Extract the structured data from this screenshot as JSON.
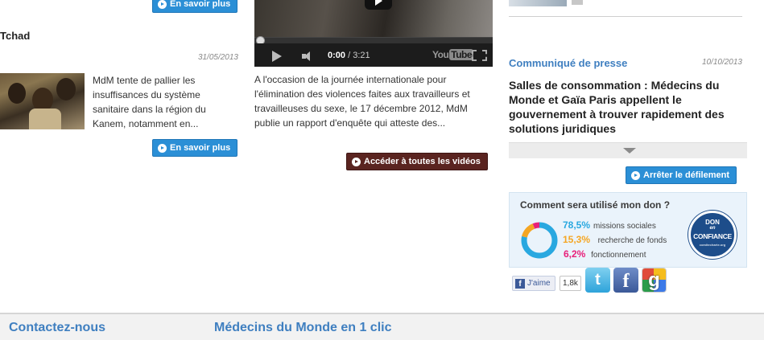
{
  "left": {
    "top_button": "En savoir plus",
    "news": {
      "title": "Tchad",
      "date": "31/05/2013",
      "text": "MdM tente de pallier les insuffisances du système sanitaire dans la région du Kanem, notamment en...",
      "button": "En savoir plus"
    }
  },
  "video": {
    "time_current": "0:00",
    "time_separator": " / ",
    "time_total": "3:21",
    "brand": "You",
    "brand_tube": "Tube",
    "progress": 0,
    "text": "A l'occasion de la journée internationale pour l'élimination des violences faites aux travailleurs et travailleuses du sexe, le 17 décembre 2012, MdM publie un rapport d'enquête qui atteste des...",
    "all_videos_button": "Accéder à toutes les vidéos"
  },
  "press": {
    "category": "Communiqué de presse",
    "date": "10/10/2013",
    "title": "Salles de consommation : Médecins du Monde et Gaïa Paris appellent le gouvernement à trouver rapidement des solutions juridiques",
    "stop_scroll_button": "Arrêter le défilement"
  },
  "donation": {
    "question": "Comment sera utilisé mon don ?",
    "stats": [
      {
        "pct": "78,5%",
        "label": "missions sociales",
        "color": "#29a8e0"
      },
      {
        "pct": "15,3%",
        "label": "recherche de fonds",
        "color": "#f5a623"
      },
      {
        "pct": "6,2%",
        "label": "fonctionnement",
        "color": "#e8207a"
      }
    ],
    "donut_fractions": [
      0.785,
      0.153,
      0.062
    ],
    "seal": {
      "line1": "DON",
      "line2": "en",
      "line3": "CONFIANCE",
      "line4": "comitecharte.org"
    }
  },
  "social": {
    "fb_like": "J'aime",
    "fb_count": "1,8k",
    "twitter_glyph": "t",
    "facebook_glyph": "f",
    "google_glyph": "g"
  },
  "footer": {
    "contact": "Contactez-nous",
    "one_click": "Médecins du Monde en 1 clic"
  }
}
